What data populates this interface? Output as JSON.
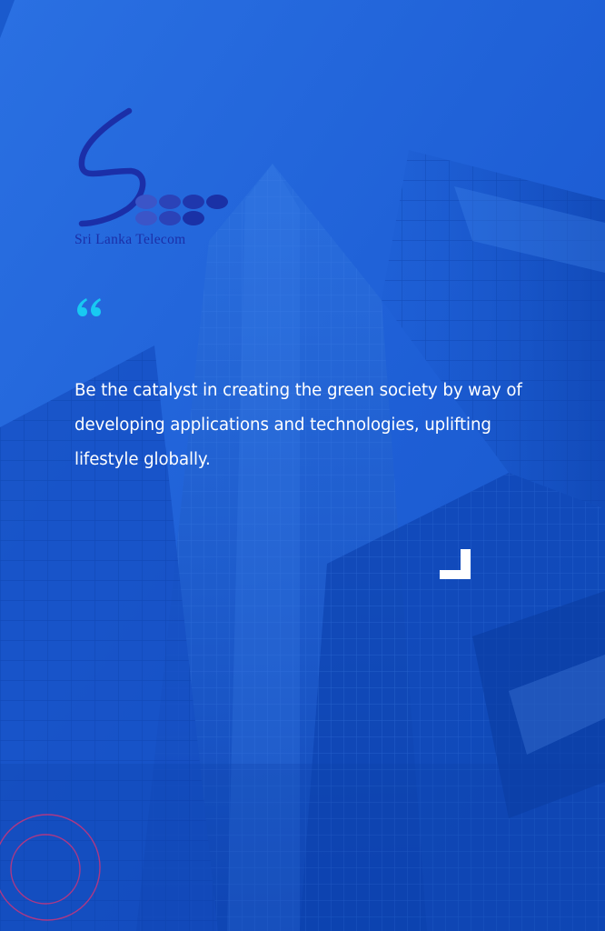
{
  "brand": {
    "name": "Sri Lanka Telecom",
    "logo_icon": "slt-logo-icon"
  },
  "quote": {
    "open_icon": "quote-open-icon",
    "close_icon": "quote-corner-icon",
    "text": "Be the catalyst in creating the green society by way of developing applications and technologies, uplifting lifestyle globally."
  },
  "colors": {
    "background": "#1f63d9",
    "text": "#ffffff",
    "quote_accent": "#18c9f2",
    "logo_blue": "#1b2fa8",
    "deco_circle": "#c9357a"
  },
  "decorations": {
    "background_image": "skyscraper-photo",
    "circle_ornament": "decorative-circles-icon"
  }
}
